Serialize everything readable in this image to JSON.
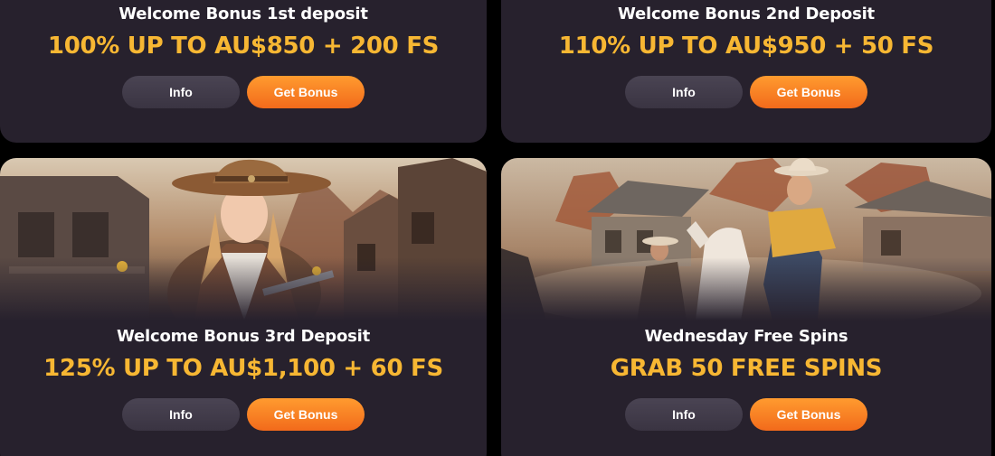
{
  "colors": {
    "page_background": "#000000",
    "card_background": "#27212d",
    "title": "#ffffff",
    "offer": "#f7b733",
    "info_button": "#433d4b",
    "bonus_button": "#f7811f"
  },
  "cards": [
    {
      "title": "Welcome Bonus 1st deposit",
      "offer": "100% UP TO AU$850 + 200 FS",
      "info_label": "Info",
      "bonus_label": "Get Bonus"
    },
    {
      "title": "Welcome Bonus 2nd Deposit",
      "offer": "110% UP TO AU$950 + 50 FS",
      "info_label": "Info",
      "bonus_label": "Get Bonus"
    },
    {
      "title": "Welcome Bonus 3rd Deposit",
      "offer": "125% UP TO AU$1,100 + 60 FS",
      "info_label": "Info",
      "bonus_label": "Get Bonus",
      "image": "cowgirl-with-revolver-western-town-illustration"
    },
    {
      "title": "Wednesday Free Spins",
      "offer": "GRAB 50 FREE SPINS",
      "info_label": "Info",
      "bonus_label": "Get Bonus",
      "image": "cowboys-on-horseback-western-town-illustration"
    }
  ]
}
